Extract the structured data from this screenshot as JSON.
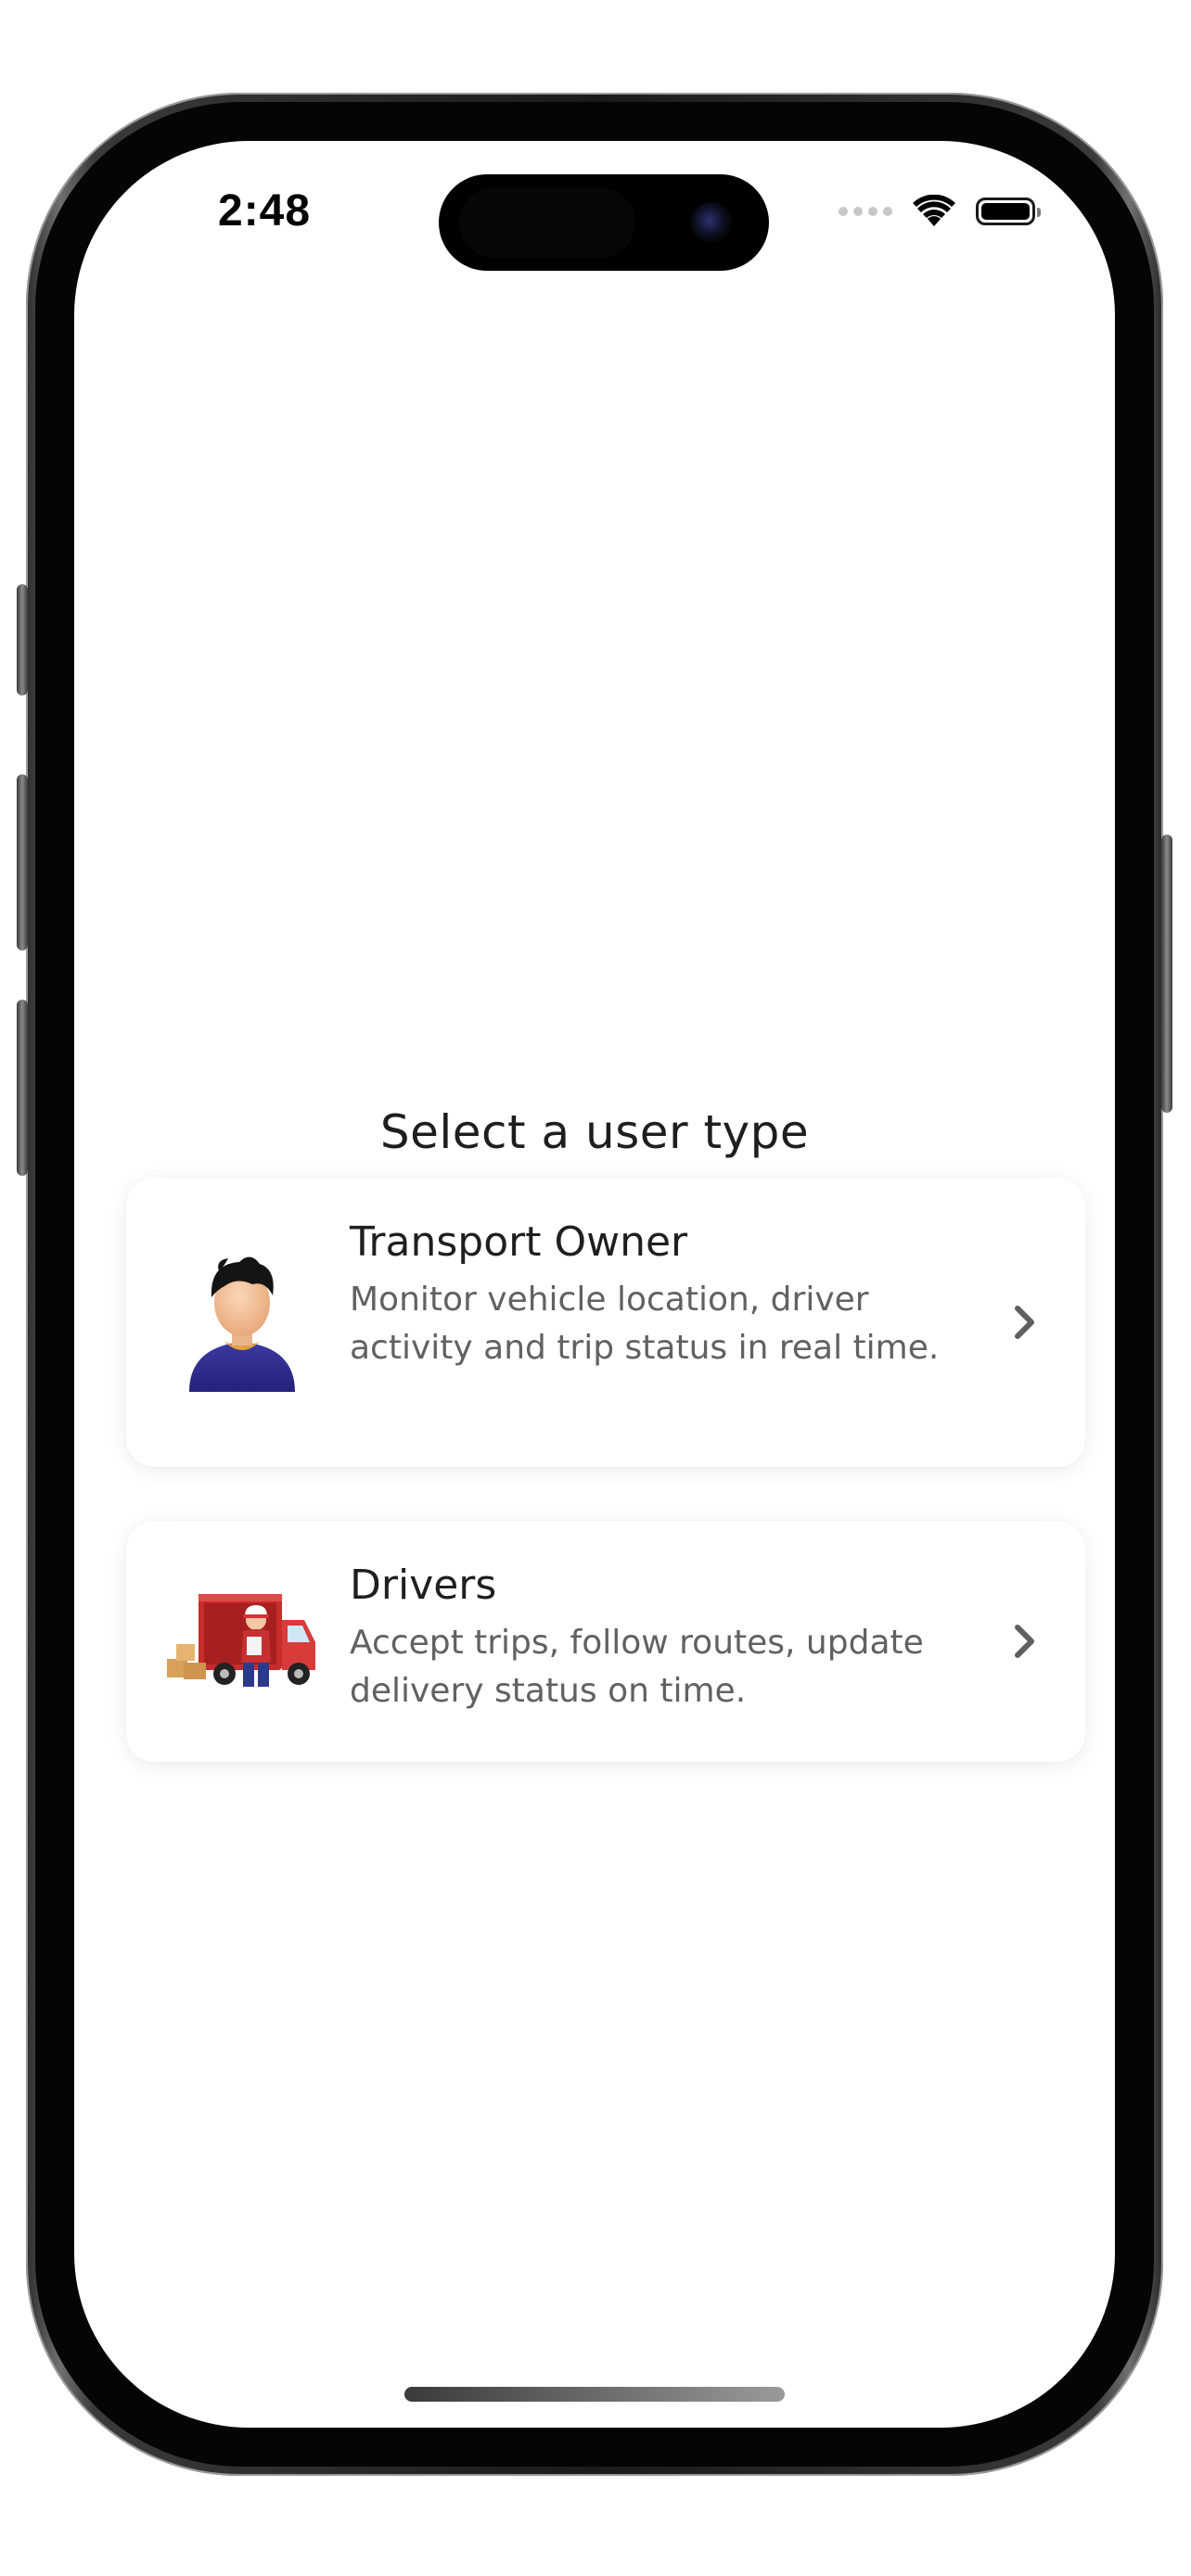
{
  "status_bar": {
    "time": "2:48",
    "icons": [
      "signal-dots-icon",
      "wifi-icon",
      "battery-icon"
    ]
  },
  "screen": {
    "title": "Select a user type"
  },
  "user_types": [
    {
      "name": "Transport Owner",
      "description": "Monitor vehicle location, driver activity and trip status in real time.",
      "icon": "person-avatar-icon"
    },
    {
      "name": "Drivers",
      "description": "Accept trips, follow routes, update delivery status on time.",
      "icon": "delivery-truck-icon"
    }
  ],
  "colors": {
    "background": "#ffffff",
    "card": "#ffffff",
    "title_text": "#1e1e1e",
    "description_text": "#616161",
    "chevron": "#5f5f5f"
  }
}
